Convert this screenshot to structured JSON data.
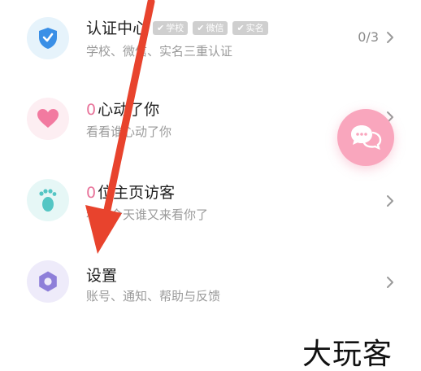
{
  "menu": {
    "items": [
      {
        "id": "verification",
        "title": "认证中心",
        "subtitle": "学校、微信、实名三重认证",
        "tags": [
          "学校",
          "微信",
          "实名"
        ],
        "right_text": "0/3",
        "icon": "shield-check-icon",
        "icon_color": "#3a8fe6",
        "icon_bg": "#e6f3fb"
      },
      {
        "id": "liked-me",
        "count": "0",
        "title": "心动了你",
        "subtitle": "看看谁心动了你",
        "icon": "heart-icon",
        "icon_color": "#f27aa0",
        "icon_bg": "#fdeef2"
      },
      {
        "id": "visitors",
        "count": "0",
        "title": "位主页访客",
        "subtitle": "看看今天谁又来看你了",
        "icon": "footprint-icon",
        "icon_color": "#54c6c4",
        "icon_bg": "#e6f7f6"
      },
      {
        "id": "settings",
        "title": "设置",
        "subtitle": "账号、通知、帮助与反馈",
        "icon": "gear-icon",
        "icon_color": "#8e7fd9",
        "icon_bg": "#eeebfa"
      }
    ]
  },
  "float_button": {
    "icon": "chat-bubbles-icon",
    "color": "#f9a6bd"
  },
  "annotation": {
    "arrow_color": "#e8432d"
  },
  "watermark": {
    "text": "大玩客"
  }
}
